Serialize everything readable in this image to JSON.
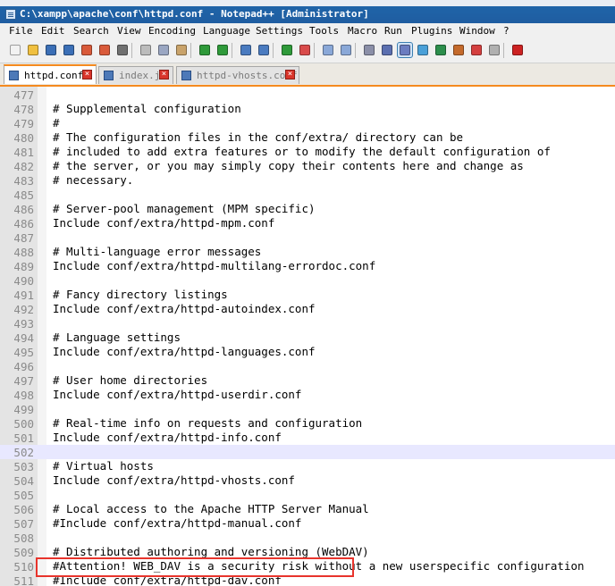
{
  "window": {
    "title": "C:\\xampp\\apache\\conf\\httpd.conf - Notepad++ [Administrator]"
  },
  "menu": [
    "File",
    "Edit",
    "Search",
    "View",
    "Encoding",
    "Language",
    "Settings",
    "Tools",
    "Macro",
    "Run",
    "Plugins",
    "Window",
    "?"
  ],
  "toolbar": {
    "buttons": [
      "new-file",
      "open-file",
      "save",
      "save-all",
      "close",
      "close-all",
      "print",
      "cut",
      "copy",
      "paste",
      "undo",
      "redo",
      "find",
      "replace",
      "zoom-in",
      "zoom-out",
      "sync-vertical",
      "sync-horizontal",
      "word-wrap",
      "show-all-characters",
      "indent-guide",
      "user-language",
      "document-map",
      "function-list",
      "folder-as-workspace",
      "monitoring",
      "record-macro"
    ]
  },
  "tabs": [
    {
      "label": "httpd.conf",
      "active": true
    },
    {
      "label": "index.js",
      "active": false
    },
    {
      "label": "httpd-vhosts.conf",
      "active": false
    }
  ],
  "editor": {
    "lines": [
      {
        "num": "477",
        "text": ""
      },
      {
        "num": "478",
        "text": "# Supplemental configuration"
      },
      {
        "num": "479",
        "text": "#"
      },
      {
        "num": "480",
        "text": "# The configuration files in the conf/extra/ directory can be"
      },
      {
        "num": "481",
        "text": "# included to add extra features or to modify the default configuration of"
      },
      {
        "num": "482",
        "text": "# the server, or you may simply copy their contents here and change as"
      },
      {
        "num": "483",
        "text": "# necessary."
      },
      {
        "num": "485",
        "text": ""
      },
      {
        "num": "486",
        "text": "# Server-pool management (MPM specific)"
      },
      {
        "num": "486",
        "text": "Include conf/extra/httpd-mpm.conf"
      },
      {
        "num": "487",
        "text": ""
      },
      {
        "num": "488",
        "text": "# Multi-language error messages"
      },
      {
        "num": "489",
        "text": "Include conf/extra/httpd-multilang-errordoc.conf"
      },
      {
        "num": "490",
        "text": ""
      },
      {
        "num": "491",
        "text": "# Fancy directory listings"
      },
      {
        "num": "492",
        "text": "Include conf/extra/httpd-autoindex.conf"
      },
      {
        "num": "493",
        "text": ""
      },
      {
        "num": "494",
        "text": "# Language settings"
      },
      {
        "num": "495",
        "text": "Include conf/extra/httpd-languages.conf"
      },
      {
        "num": "496",
        "text": ""
      },
      {
        "num": "497",
        "text": "# User home directories"
      },
      {
        "num": "498",
        "text": "Include conf/extra/httpd-userdir.conf"
      },
      {
        "num": "499",
        "text": ""
      },
      {
        "num": "500",
        "text": "# Real-time info on requests and configuration"
      },
      {
        "num": "501",
        "text": "Include conf/extra/httpd-info.conf"
      },
      {
        "num": "502",
        "text": "",
        "current": true
      },
      {
        "num": "503",
        "text": "# Virtual hosts"
      },
      {
        "num": "504",
        "text": "Include conf/extra/httpd-vhosts.conf"
      },
      {
        "num": "505",
        "text": ""
      },
      {
        "num": "506",
        "text": "# Local access to the Apache HTTP Server Manual"
      },
      {
        "num": "507",
        "text": "#Include conf/extra/httpd-manual.conf"
      },
      {
        "num": "508",
        "text": ""
      },
      {
        "num": "509",
        "text": "# Distributed authoring and versioning (WebDAV)"
      },
      {
        "num": "510",
        "text": "#Attention! WEB_DAV is a security risk without a new userspecific configuration"
      },
      {
        "num": "511",
        "text": "#Include conf/extra/httpd-dav.conf"
      }
    ]
  },
  "colors": {
    "titlebar": "#1f5da1",
    "active_tab_accent": "#f58a1f",
    "highlight_box": "#e8342c",
    "current_line": "#e8e8ff"
  }
}
